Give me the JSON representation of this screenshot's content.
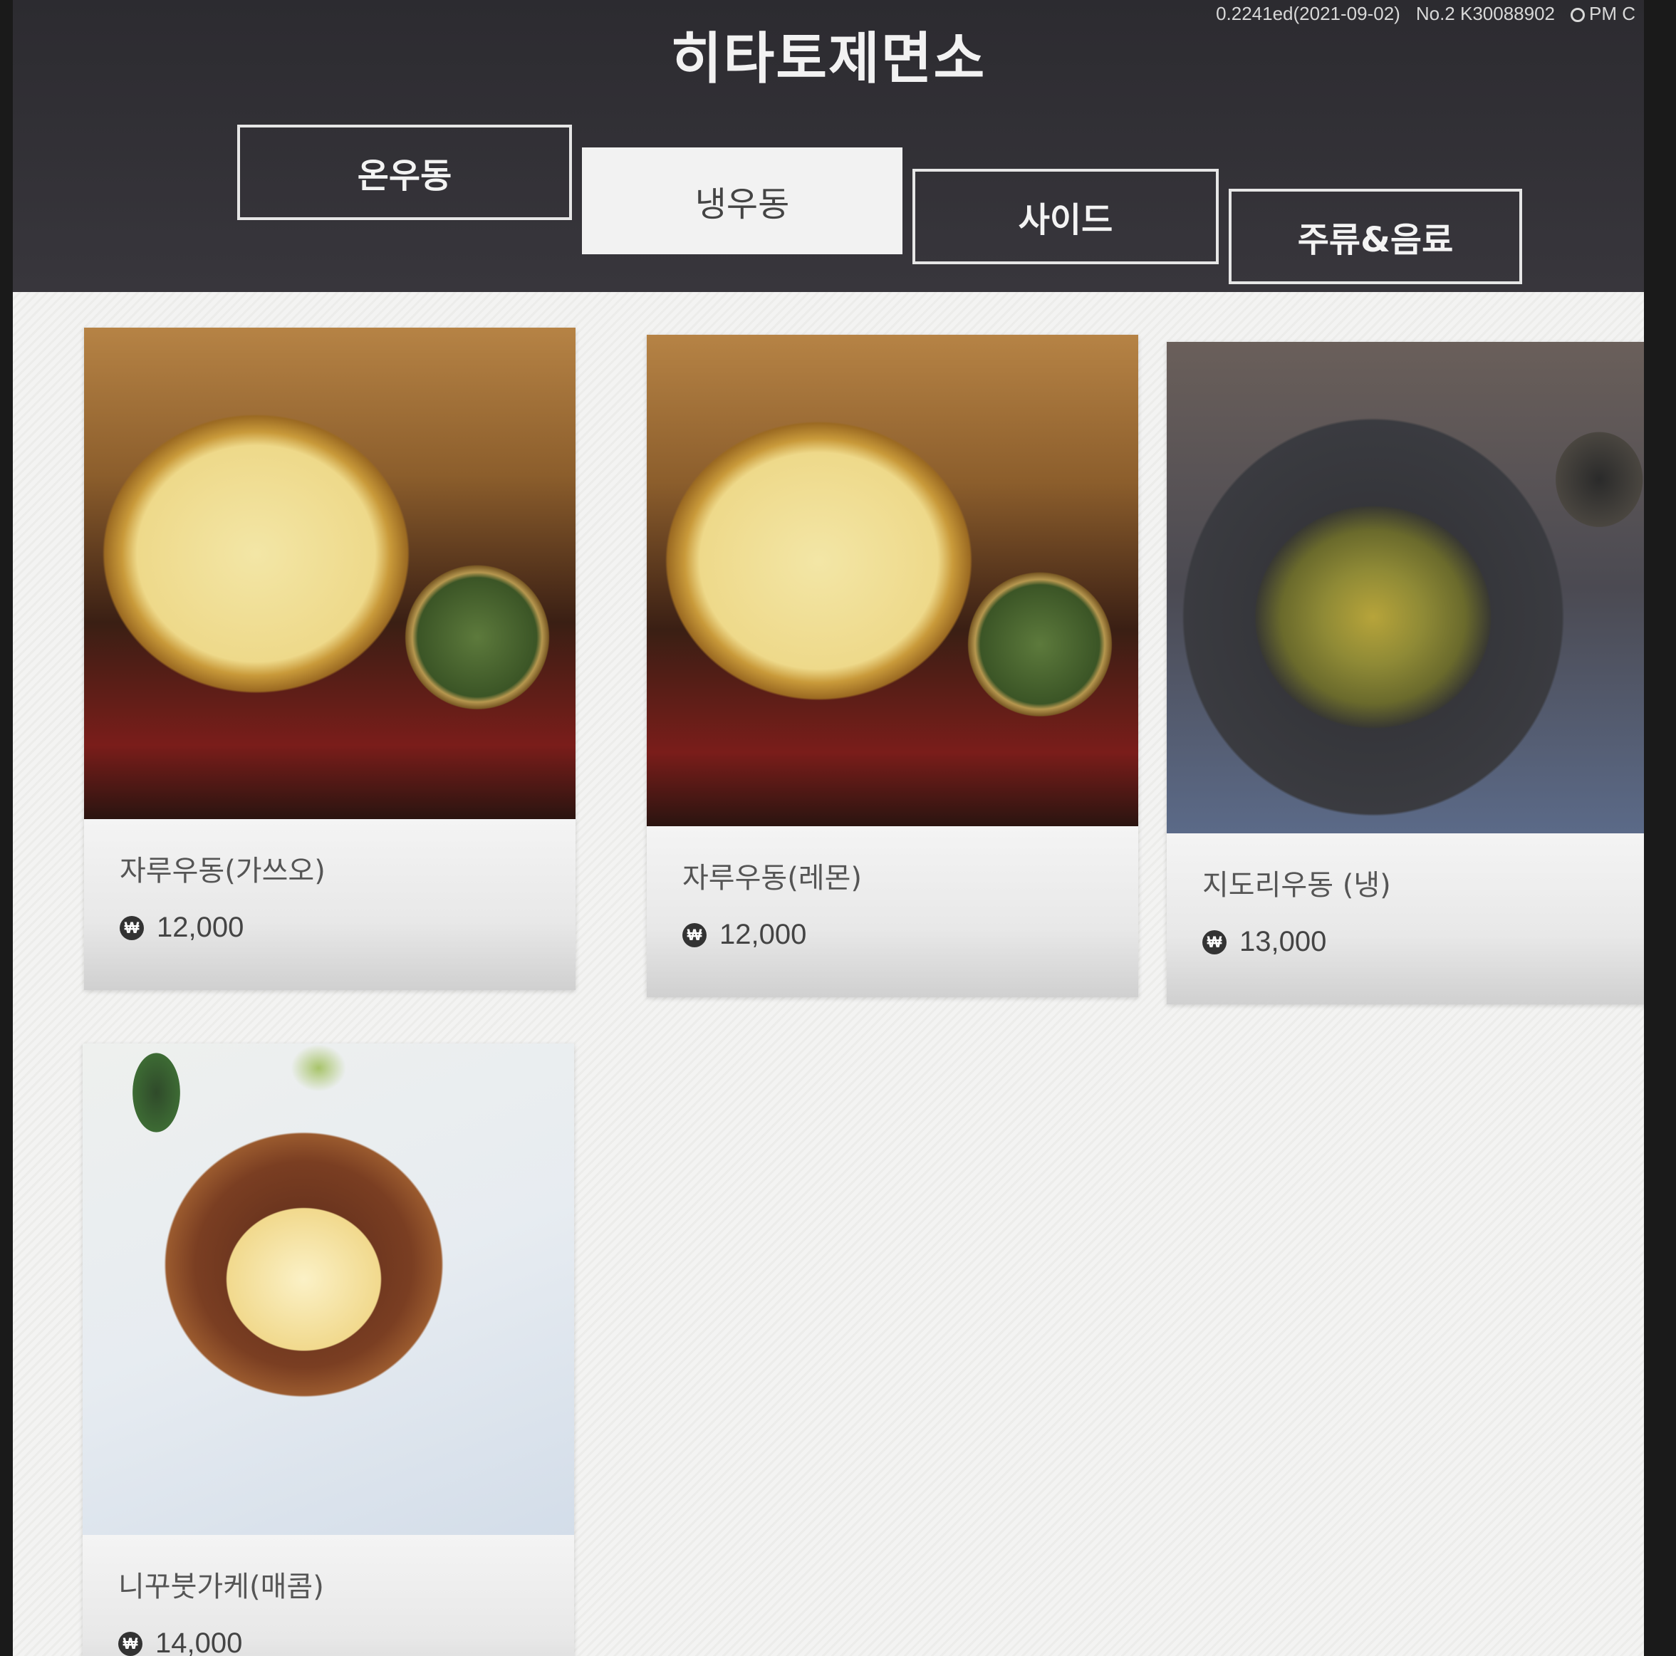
{
  "status_bar": {
    "version": "0.2241ed(2021-09-02)",
    "terminal": "No.2 K30088902",
    "time": "PM C"
  },
  "store_name": "히타토제면소",
  "tabs": [
    {
      "label": "온우동",
      "active": false
    },
    {
      "label": "냉우동",
      "active": true
    },
    {
      "label": "사이드",
      "active": false
    },
    {
      "label": "주류&음료",
      "active": false
    }
  ],
  "currency_icon": "won-icon",
  "menu_items": [
    {
      "name": "자루우동(가쓰오)",
      "price": "12,000",
      "image": "zaru-udon-photo"
    },
    {
      "name": "자루우동(레몬)",
      "price": "12,000",
      "image": "zaru-udon-photo"
    },
    {
      "name": "지도리우동 (냉)",
      "price": "13,000",
      "image": "jidori-udon-photo"
    },
    {
      "name": "니꾸붓가케(매콤)",
      "price": "14,000",
      "image": "niku-bukkake-photo"
    }
  ],
  "colors": {
    "header_bg": "#2c2b30",
    "active_tab_bg": "#f2f2f2",
    "content_bg": "#f0f0ee"
  }
}
